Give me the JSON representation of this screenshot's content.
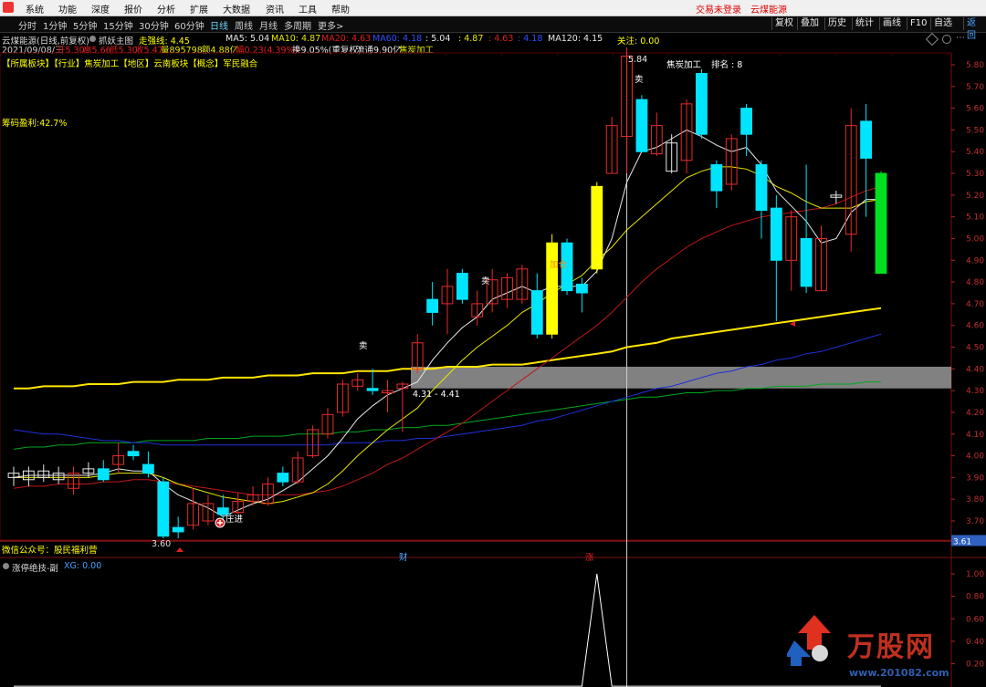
{
  "menu": {
    "items": [
      "系统",
      "功能",
      "深度",
      "报价",
      "分析",
      "扩展",
      "大数据",
      "资讯",
      "工具",
      "帮助"
    ],
    "login": "交易未登录",
    "stock_name": "云煤能源"
  },
  "toolbar": {
    "periods": [
      "分时",
      "1分钟",
      "5分钟",
      "15分钟",
      "30分钟",
      "60分钟",
      "日线",
      "周线",
      "月线",
      "多周期",
      "更多>"
    ],
    "active_period": "日线",
    "buttons": [
      "复权",
      "叠加",
      "历史",
      "统计",
      "画线",
      "F10",
      "自选",
      "返回"
    ]
  },
  "info": {
    "title": "云煤能源(日线,前复权)",
    "indicator_name": "抓妖主图",
    "trend_label": "走强线: 4.45",
    "ma5": "MA5: 5.04",
    "ma10": "MA10: 4.87",
    "ma20": "MA20: 4.63",
    "ma60": "MA60: 4.18",
    "ma_extra1": ": 5.04",
    "ma_extra2": ": 4.87",
    "ma_extra3": ": 4.63",
    "ma_extra4": ": 4.18",
    "ma120": "MA120: 4.15",
    "attention": "关注: 0.00",
    "date_line": "2021/09/08/三",
    "open": "开5.30",
    "high": "高5.66",
    "low": "低5.30",
    "close": "收5.47",
    "volume": "量895798",
    "amount": "额4.88亿",
    "change": "幅0.23(4.39%)",
    "turnover": "换9.05%(重复权)",
    "float_shares": "流通9.90亿",
    "industry_tag": "焦炭加工",
    "sectors": "【所属板块】【行业】焦炭加工【地区】云南板块【概念】军民融合",
    "profit_ratio": "筹码盈利:42.7%"
  },
  "annotations": {
    "peak": "5.84",
    "sector_label": "焦炭加工",
    "rank": "排名 : 8",
    "range_label": "4.31 - 4.41",
    "zhuang": "庄进",
    "low_price": "3.60",
    "sell1": "卖",
    "sell2": "卖",
    "sell3": "卖",
    "buy_mark": "加仓",
    "wechat": "微信公众号：股民福利营",
    "cai": "财",
    "zhang": "涨"
  },
  "sub": {
    "title": "涨停绝技-副",
    "xg": "XG: 0.00"
  },
  "watermark": {
    "brand": "万股网",
    "url": "www.201082.com"
  },
  "colors": {
    "up": "#e82b2b",
    "down": "#00e5ff",
    "yellow": "#ffff00",
    "green_bar": "#00e020",
    "ma5": "#e8e8e8",
    "ma10": "#e8e800",
    "ma20": "#c01818",
    "ma60": "#2030d8",
    "ma120": "#00a820",
    "trend": "#ffe600"
  },
  "chart_data": [
    {
      "type": "candlestick",
      "ylim": [
        3.6,
        5.9
      ],
      "y_ticks": [
        3.7,
        3.8,
        3.9,
        4.0,
        4.1,
        4.2,
        4.3,
        4.4,
        4.5,
        4.6,
        4.7,
        4.8,
        4.9,
        5.0,
        5.1,
        5.2,
        5.3,
        5.4,
        5.5,
        5.6,
        5.7,
        5.8
      ],
      "current_price_tag": "3.61",
      "candles": [
        [
          3.9,
          3.92,
          3.95,
          3.86,
          "n"
        ],
        [
          3.93,
          3.89,
          3.95,
          3.86,
          "n"
        ],
        [
          3.9,
          3.93,
          3.96,
          3.88,
          "n"
        ],
        [
          3.92,
          3.89,
          3.95,
          3.87,
          "n"
        ],
        [
          3.85,
          3.92,
          3.95,
          3.82,
          "u"
        ],
        [
          3.92,
          3.94,
          3.97,
          3.9,
          "n"
        ],
        [
          3.94,
          3.89,
          3.98,
          3.88,
          "d"
        ],
        [
          3.96,
          4.0,
          4.06,
          3.92,
          "u"
        ],
        [
          4.02,
          4.0,
          4.05,
          3.98,
          "d"
        ],
        [
          3.96,
          3.92,
          4.02,
          3.9,
          "d"
        ],
        [
          3.88,
          3.63,
          3.9,
          3.62,
          "d"
        ],
        [
          3.65,
          3.67,
          3.72,
          3.62,
          "d"
        ],
        [
          3.68,
          3.78,
          3.85,
          3.66,
          "u"
        ],
        [
          3.7,
          3.78,
          3.82,
          3.68,
          "u"
        ],
        [
          3.76,
          3.73,
          3.82,
          3.71,
          "d"
        ],
        [
          3.74,
          3.79,
          3.83,
          3.73,
          "u"
        ],
        [
          3.79,
          3.82,
          3.86,
          3.77,
          "u"
        ],
        [
          3.78,
          3.87,
          3.9,
          3.77,
          "u"
        ],
        [
          3.88,
          3.92,
          3.95,
          3.86,
          "d"
        ],
        [
          3.88,
          3.99,
          4.02,
          3.87,
          "u"
        ],
        [
          4.0,
          4.12,
          4.14,
          3.99,
          "u"
        ],
        [
          4.1,
          4.19,
          4.22,
          4.08,
          "u"
        ],
        [
          4.2,
          4.33,
          4.35,
          4.18,
          "u"
        ],
        [
          4.32,
          4.35,
          4.38,
          4.3,
          "u"
        ],
        [
          4.31,
          4.3,
          4.4,
          4.28,
          "d"
        ],
        [
          4.3,
          4.29,
          4.35,
          4.2,
          "u"
        ],
        [
          4.31,
          4.33,
          4.34,
          4.11,
          "u"
        ],
        [
          4.4,
          4.52,
          4.56,
          4.38,
          "u"
        ],
        [
          4.72,
          4.66,
          4.8,
          4.6,
          "d"
        ],
        [
          4.7,
          4.78,
          4.86,
          4.56,
          "u"
        ],
        [
          4.84,
          4.72,
          4.86,
          4.7,
          "d"
        ],
        [
          4.64,
          4.7,
          4.76,
          4.6,
          "u"
        ],
        [
          4.7,
          4.81,
          4.86,
          4.66,
          "u"
        ],
        [
          4.72,
          4.82,
          4.84,
          4.68,
          "u"
        ],
        [
          4.72,
          4.86,
          4.88,
          4.7,
          "u"
        ],
        [
          4.76,
          4.56,
          4.84,
          4.54,
          "d"
        ],
        [
          4.56,
          4.98,
          5.02,
          4.54,
          "y"
        ],
        [
          4.98,
          4.76,
          5.0,
          4.74,
          "d"
        ],
        [
          4.79,
          4.75,
          4.82,
          4.66,
          "d"
        ],
        [
          4.86,
          5.24,
          5.26,
          4.84,
          "y"
        ],
        [
          5.3,
          5.52,
          5.56,
          5.3,
          "u"
        ],
        [
          5.47,
          5.84,
          5.88,
          5.3,
          "u"
        ],
        [
          5.64,
          5.4,
          5.66,
          5.4,
          "d"
        ],
        [
          5.52,
          5.39,
          5.58,
          5.38,
          "u"
        ],
        [
          5.31,
          5.44,
          5.48,
          5.3,
          "n"
        ],
        [
          5.36,
          5.62,
          5.64,
          5.3,
          "u"
        ],
        [
          5.76,
          5.48,
          5.78,
          5.46,
          "d"
        ],
        [
          5.34,
          5.22,
          5.36,
          5.14,
          "d"
        ],
        [
          5.25,
          5.46,
          5.48,
          5.22,
          "u"
        ],
        [
          5.6,
          5.48,
          5.62,
          5.38,
          "d"
        ],
        [
          5.34,
          5.13,
          5.36,
          5.0,
          "d"
        ],
        [
          5.14,
          4.9,
          5.2,
          4.62,
          "d"
        ],
        [
          4.9,
          5.1,
          5.13,
          4.76,
          "u"
        ],
        [
          5.0,
          4.78,
          5.34,
          4.75,
          "d"
        ],
        [
          4.76,
          5.0,
          5.06,
          4.76,
          "u"
        ],
        [
          5.2,
          5.19,
          5.22,
          5.16,
          "n"
        ],
        [
          5.02,
          5.52,
          5.6,
          4.94,
          "u"
        ],
        [
          5.54,
          5.37,
          5.62,
          5.1,
          "d"
        ],
        [
          5.3,
          4.84,
          5.31,
          4.84,
          "g"
        ]
      ],
      "lines": {
        "ma5": [
          3.9,
          3.91,
          3.91,
          3.91,
          3.91,
          3.91,
          3.92,
          3.94,
          3.93,
          3.93,
          3.87,
          3.82,
          3.79,
          3.76,
          3.72,
          3.75,
          3.78,
          3.8,
          3.84,
          3.88,
          3.94,
          4.0,
          4.08,
          4.17,
          4.23,
          4.28,
          4.31,
          4.34,
          4.44,
          4.52,
          4.59,
          4.64,
          4.72,
          4.75,
          4.78,
          4.75,
          4.78,
          4.78,
          4.78,
          4.85,
          5.0,
          5.26,
          5.4,
          5.42,
          5.46,
          5.5,
          5.47,
          5.43,
          5.4,
          5.42,
          5.34,
          5.22,
          5.15,
          5.08,
          4.98,
          5.0,
          5.12,
          5.18,
          5.18
        ],
        "ma10": [
          3.9,
          3.9,
          3.9,
          3.9,
          3.9,
          3.9,
          3.91,
          3.92,
          3.92,
          3.92,
          3.9,
          3.87,
          3.85,
          3.83,
          3.81,
          3.8,
          3.79,
          3.78,
          3.79,
          3.81,
          3.83,
          3.87,
          3.93,
          4.0,
          4.06,
          4.12,
          4.17,
          4.22,
          4.3,
          4.37,
          4.44,
          4.5,
          4.55,
          4.6,
          4.66,
          4.7,
          4.75,
          4.79,
          4.83,
          4.9,
          4.96,
          5.04,
          5.1,
          5.16,
          5.22,
          5.28,
          5.31,
          5.33,
          5.33,
          5.32,
          5.29,
          5.24,
          5.21,
          5.17,
          5.14,
          5.14,
          5.14,
          5.17,
          5.18
        ],
        "ma20": [
          3.85,
          3.86,
          3.86,
          3.87,
          3.87,
          3.87,
          3.88,
          3.88,
          3.89,
          3.89,
          3.88,
          3.87,
          3.86,
          3.85,
          3.84,
          3.83,
          3.82,
          3.82,
          3.82,
          3.82,
          3.83,
          3.84,
          3.86,
          3.89,
          3.92,
          3.96,
          3.99,
          4.03,
          4.07,
          4.11,
          4.15,
          4.2,
          4.25,
          4.3,
          4.35,
          4.4,
          4.45,
          4.5,
          4.55,
          4.6,
          4.66,
          4.73,
          4.8,
          4.86,
          4.91,
          4.96,
          5.0,
          5.03,
          5.06,
          5.08,
          5.1,
          5.11,
          5.12,
          5.13,
          5.14,
          5.16,
          5.19,
          5.22,
          5.24
        ],
        "ma60": [
          4.12,
          4.11,
          4.1,
          4.1,
          4.09,
          4.08,
          4.07,
          4.07,
          4.06,
          4.06,
          4.05,
          4.05,
          4.05,
          4.05,
          4.05,
          4.05,
          4.05,
          4.05,
          4.05,
          4.05,
          4.05,
          4.05,
          4.06,
          4.06,
          4.06,
          4.07,
          4.07,
          4.08,
          4.08,
          4.09,
          4.1,
          4.11,
          4.12,
          4.13,
          4.14,
          4.16,
          4.17,
          4.19,
          4.21,
          4.23,
          4.25,
          4.27,
          4.29,
          4.31,
          4.32,
          4.34,
          4.36,
          4.38,
          4.39,
          4.41,
          4.42,
          4.44,
          4.45,
          4.47,
          4.48,
          4.5,
          4.52,
          4.54,
          4.56
        ],
        "ma120": [
          4.03,
          4.04,
          4.04,
          4.05,
          4.05,
          4.06,
          4.06,
          4.06,
          4.06,
          4.07,
          4.07,
          4.07,
          4.07,
          4.08,
          4.08,
          4.08,
          4.09,
          4.09,
          4.09,
          4.1,
          4.1,
          4.1,
          4.11,
          4.11,
          4.12,
          4.12,
          4.13,
          4.13,
          4.14,
          4.14,
          4.15,
          4.16,
          4.17,
          4.18,
          4.19,
          4.2,
          4.21,
          4.22,
          4.23,
          4.24,
          4.25,
          4.26,
          4.27,
          4.27,
          4.28,
          4.29,
          4.29,
          4.3,
          4.3,
          4.31,
          4.31,
          4.32,
          4.32,
          4.32,
          4.33,
          4.33,
          4.33,
          4.34,
          4.34
        ],
        "trend": [
          4.31,
          4.31,
          4.32,
          4.32,
          4.32,
          4.33,
          4.33,
          4.33,
          4.34,
          4.34,
          4.34,
          4.35,
          4.35,
          4.35,
          4.36,
          4.36,
          4.36,
          4.37,
          4.37,
          4.37,
          4.38,
          4.38,
          4.38,
          4.39,
          4.39,
          4.39,
          4.4,
          4.4,
          4.4,
          4.41,
          4.41,
          4.41,
          4.42,
          4.42,
          4.42,
          4.43,
          4.44,
          4.45,
          4.46,
          4.47,
          4.48,
          4.5,
          4.51,
          4.52,
          4.54,
          4.55,
          4.56,
          4.57,
          4.58,
          4.59,
          4.6,
          4.61,
          4.62,
          4.63,
          4.64,
          4.65,
          4.66,
          4.67,
          4.68
        ]
      },
      "band": [
        4.31,
        4.41
      ]
    },
    {
      "type": "line",
      "title": "涨停绝技-副",
      "ylim": [
        0,
        1.05
      ],
      "y_ticks": [
        0.2,
        0.4,
        0.6,
        0.8,
        1.0
      ],
      "values": [
        0,
        0,
        0,
        0,
        0,
        0,
        0,
        0,
        0,
        0,
        0,
        0,
        0,
        0,
        0,
        0,
        0,
        0,
        0,
        0,
        0,
        0,
        0,
        0,
        0,
        0,
        0,
        0,
        0,
        0,
        0,
        0,
        0,
        0,
        0,
        0,
        0,
        0,
        0,
        1,
        0,
        0,
        0,
        0,
        0,
        0,
        0,
        0,
        0,
        0,
        0,
        0,
        0,
        0,
        0,
        0,
        0,
        0,
        0
      ]
    }
  ]
}
